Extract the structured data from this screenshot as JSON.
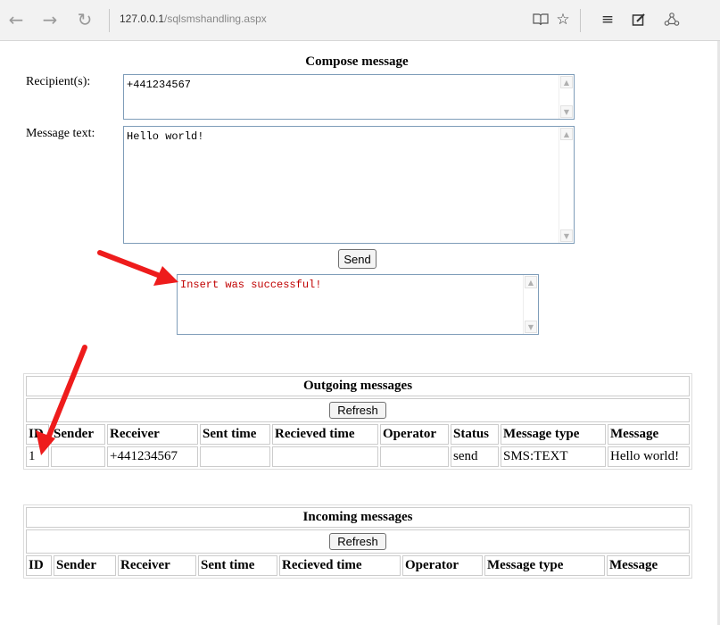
{
  "browser": {
    "address_host": "127.0.0.1",
    "address_path": "/sqlsmshandling.aspx",
    "icons": [
      "back-icon",
      "forward-icon",
      "refresh-icon",
      "reading-view-icon",
      "favorite-star-icon",
      "hub-icon",
      "web-note-icon",
      "share-icon"
    ]
  },
  "compose": {
    "title": "Compose message",
    "recipients_label": "Recipient(s):",
    "recipients_value": "+441234567",
    "message_label": "Message text:",
    "message_value": "Hello world!",
    "send_label": "Send",
    "result_text": "Insert was successful!"
  },
  "outgoing": {
    "title": "Outgoing messages",
    "refresh_label": "Refresh",
    "columns": [
      "ID",
      "Sender",
      "Receiver",
      "Sent time",
      "Recieved time",
      "Operator",
      "Status",
      "Message type",
      "Message"
    ],
    "rows": [
      [
        "1",
        "",
        "+441234567",
        "",
        "",
        "",
        "send",
        "SMS:TEXT",
        "Hello world!"
      ]
    ]
  },
  "incoming": {
    "title": "Incoming messages",
    "refresh_label": "Refresh",
    "columns": [
      "ID",
      "Sender",
      "Receiver",
      "Sent time",
      "Recieved time",
      "Operator",
      "Message type",
      "Message"
    ]
  },
  "annotation_color": "#ee1c1c"
}
